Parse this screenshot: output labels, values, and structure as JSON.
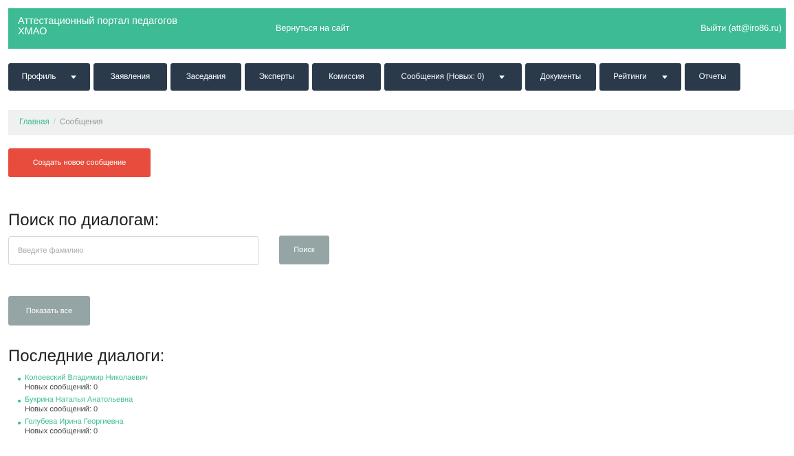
{
  "header": {
    "brand": "Аттестационный портал педагогов ХМАО",
    "back_link": "Вернуться на сайт",
    "logout_link": "Выйти (att@iro86.ru)",
    "color": "#3dbb94"
  },
  "nav": {
    "items": [
      {
        "label": "Профиль",
        "dropdown": true
      },
      {
        "label": "Заявления",
        "dropdown": false
      },
      {
        "label": "Заседания",
        "dropdown": false
      },
      {
        "label": "Эксперты",
        "dropdown": false
      },
      {
        "label": "Комиссия",
        "dropdown": false
      },
      {
        "label": "Сообщения (Новых: 0)",
        "dropdown": true
      },
      {
        "label": "Документы",
        "dropdown": false
      },
      {
        "label": "Рейтинги",
        "dropdown": true
      },
      {
        "label": "Отчеты",
        "dropdown": false
      }
    ],
    "color": "#2b3a4b"
  },
  "breadcrumb": {
    "home": "Главная",
    "separator": "/",
    "current": "Сообщения"
  },
  "actions": {
    "create_label": "Создать новое сообщение",
    "create_color": "#e74c3c"
  },
  "search": {
    "heading": "Поиск по диалогам:",
    "placeholder": "Введите фамилию",
    "button_label": "Поиск",
    "show_all_label": "Показать все"
  },
  "recent": {
    "heading": "Последние диалоги:",
    "dialogs": [
      {
        "name": "Колоевский Владимир Николаевич",
        "count_text": "Новых сообщений: 0"
      },
      {
        "name": "Букрина Наталья Анатольевна",
        "count_text": "Новых сообщений: 0"
      },
      {
        "name": "Голубева Ирина Георгиевна",
        "count_text": "Новых сообщений: 0"
      }
    ]
  }
}
